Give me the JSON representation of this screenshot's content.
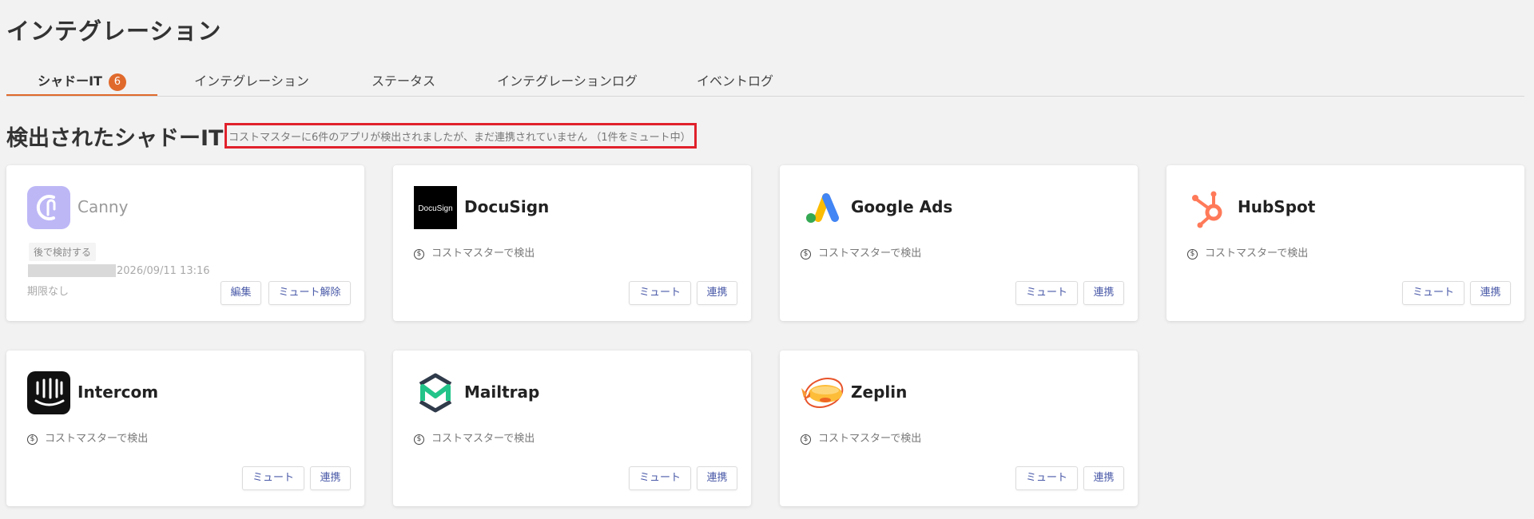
{
  "page": {
    "title": "インテグレーション"
  },
  "tabs": [
    {
      "label": "シャドーIT",
      "badge": "6",
      "active": true
    },
    {
      "label": "インテグレーション"
    },
    {
      "label": "ステータス"
    },
    {
      "label": "インテグレーションログ"
    },
    {
      "label": "イベントログ"
    }
  ],
  "section": {
    "title": "検出されたシャドーIT",
    "subtitle": "コストマスターに6件のアプリが検出されましたが、まだ連携されていません （1件をミュート中）"
  },
  "cards": [
    {
      "name": "Canny",
      "status": "muted",
      "tag": "後で検討する",
      "date": "2026/09/11 13:16",
      "expiry": "期限なし",
      "buttons": {
        "edit": "編集",
        "unmute": "ミュート解除"
      }
    },
    {
      "name": "DocuSign",
      "logo_text": "DocuSign",
      "detect": "コストマスターで検出",
      "buttons": {
        "mute": "ミュート",
        "link": "連携"
      }
    },
    {
      "name": "Google Ads",
      "detect": "コストマスターで検出",
      "buttons": {
        "mute": "ミュート",
        "link": "連携"
      }
    },
    {
      "name": "HubSpot",
      "detect": "コストマスターで検出",
      "buttons": {
        "mute": "ミュート",
        "link": "連携"
      }
    },
    {
      "name": "Intercom",
      "detect": "コストマスターで検出",
      "buttons": {
        "mute": "ミュート",
        "link": "連携"
      }
    },
    {
      "name": "Mailtrap",
      "detect": "コストマスターで検出",
      "buttons": {
        "mute": "ミュート",
        "link": "連携"
      }
    },
    {
      "name": "Zeplin",
      "detect": "コストマスターで検出",
      "buttons": {
        "mute": "ミュート",
        "link": "連携"
      }
    }
  ],
  "icons": {
    "detect": "dollar-circle-icon",
    "dollar_glyph": "$"
  },
  "colors": {
    "accent": "#e06a2c",
    "highlight_border": "#e0212b",
    "button_text": "#4a5aa8"
  }
}
